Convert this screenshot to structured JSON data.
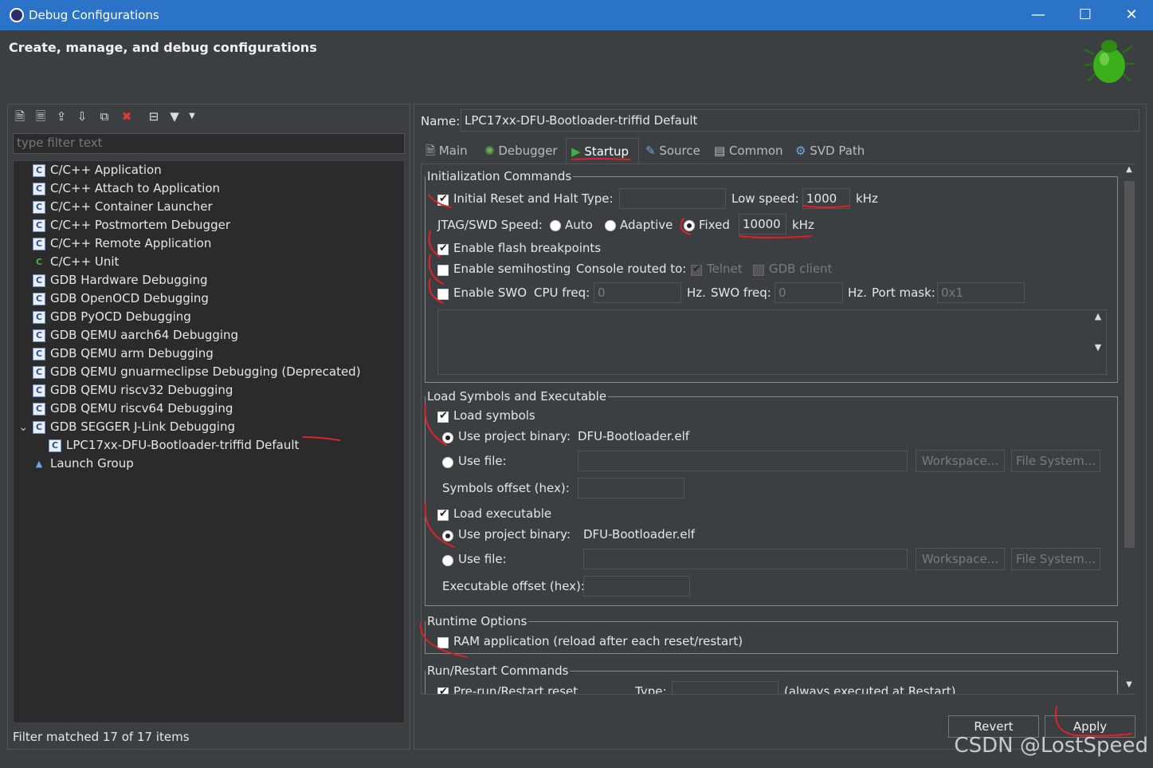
{
  "window": {
    "title": "Debug Configurations"
  },
  "header": {
    "title": "Create, manage, and debug configurations"
  },
  "left": {
    "filter_placeholder": "type filter text",
    "tree": [
      {
        "label": "C/C++ Application",
        "icon": "c-config-icon"
      },
      {
        "label": "C/C++ Attach to Application",
        "icon": "c-config-icon"
      },
      {
        "label": "C/C++ Container Launcher",
        "icon": "c-config-icon"
      },
      {
        "label": "C/C++ Postmortem Debugger",
        "icon": "c-config-icon"
      },
      {
        "label": "C/C++ Remote Application",
        "icon": "c-config-icon"
      },
      {
        "label": "C/C++ Unit",
        "icon": "c-unit-icon"
      },
      {
        "label": "GDB Hardware Debugging",
        "icon": "c-config-icon"
      },
      {
        "label": "GDB OpenOCD Debugging",
        "icon": "c-config-icon"
      },
      {
        "label": "GDB PyOCD Debugging",
        "icon": "c-config-icon"
      },
      {
        "label": "GDB QEMU aarch64 Debugging",
        "icon": "c-config-icon"
      },
      {
        "label": "GDB QEMU arm Debugging",
        "icon": "c-config-icon"
      },
      {
        "label": "GDB QEMU gnuarmeclipse Debugging (Deprecated)",
        "icon": "c-config-icon"
      },
      {
        "label": "GDB QEMU riscv32 Debugging",
        "icon": "c-config-icon"
      },
      {
        "label": "GDB QEMU riscv64 Debugging",
        "icon": "c-config-icon"
      },
      {
        "label": "GDB SEGGER J-Link Debugging",
        "icon": "c-config-icon",
        "expanded": true
      },
      {
        "label": "LPC17xx-DFU-Bootloader-triffid Default",
        "icon": "c-config-icon",
        "child": true
      },
      {
        "label": "Launch Group",
        "icon": "launch-group-icon"
      }
    ],
    "status": "Filter matched 17 of 17 items"
  },
  "right": {
    "name_label": "Name:",
    "name_value": "LPC17xx-DFU-Bootloader-triffid Default",
    "tabs": [
      "Main",
      "Debugger",
      "Startup",
      "Source",
      "Common",
      "SVD Path"
    ],
    "active_tab": "Startup",
    "init": {
      "legend": "Initialization Commands",
      "initial_reset": "Initial Reset and Halt",
      "type_label": "Type:",
      "type_value": "",
      "low_speed_label": "Low speed:",
      "low_speed_value": "1000",
      "khz": "kHz",
      "jtag_label": "JTAG/SWD Speed:",
      "auto": "Auto",
      "adaptive": "Adaptive",
      "fixed": "Fixed",
      "fixed_value": "10000",
      "flash_bp": "Enable flash breakpoints",
      "semihosting": "Enable semihosting",
      "console_routed": "Console routed to:",
      "telnet": "Telnet",
      "gdb_client": "GDB client",
      "swo": "Enable SWO",
      "cpu_freq": "CPU freq:",
      "cpu_freq_value": "0",
      "hz1": "Hz.",
      "swo_freq": "SWO freq:",
      "swo_freq_value": "0",
      "hz2": "Hz.",
      "port_mask": "Port mask:",
      "port_mask_value": "0x1"
    },
    "load": {
      "legend": "Load Symbols and Executable",
      "load_symbols": "Load symbols",
      "use_project_binary": "Use project binary:",
      "symbols_binary": "DFU-Bootloader.elf",
      "use_file": "Use file:",
      "workspace": "Workspace...",
      "filesystem": "File System...",
      "symbols_offset": "Symbols offset (hex):",
      "load_executable": "Load executable",
      "exe_binary": "DFU-Bootloader.elf",
      "exe_offset": "Executable offset (hex):"
    },
    "runtime": {
      "legend": "Runtime Options",
      "ram_app": "RAM application (reload after each reset/restart)"
    },
    "restart": {
      "legend": "Run/Restart Commands",
      "pre_run": "Pre-run/Restart reset",
      "type_label": "Type:",
      "always": "(always executed at Restart)"
    },
    "buttons": {
      "revert": "Revert",
      "apply": "Apply"
    }
  },
  "watermark": "CSDN @LostSpeed",
  "colors": {
    "titlebar": "#2b73c7",
    "annotation": "#e0202a",
    "background": "#3c3f41"
  }
}
